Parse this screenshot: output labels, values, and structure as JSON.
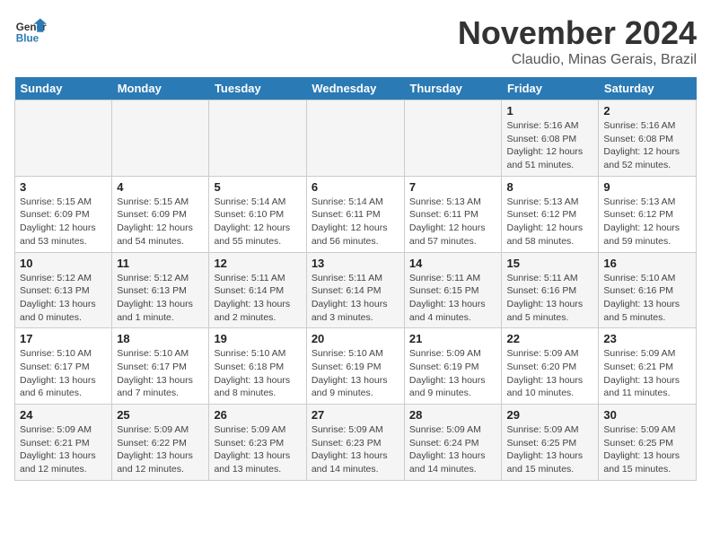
{
  "header": {
    "logo_line1": "General",
    "logo_line2": "Blue",
    "month_title": "November 2024",
    "location": "Claudio, Minas Gerais, Brazil"
  },
  "weekdays": [
    "Sunday",
    "Monday",
    "Tuesday",
    "Wednesday",
    "Thursday",
    "Friday",
    "Saturday"
  ],
  "weeks": [
    [
      {
        "day": "",
        "info": ""
      },
      {
        "day": "",
        "info": ""
      },
      {
        "day": "",
        "info": ""
      },
      {
        "day": "",
        "info": ""
      },
      {
        "day": "",
        "info": ""
      },
      {
        "day": "1",
        "info": "Sunrise: 5:16 AM\nSunset: 6:08 PM\nDaylight: 12 hours\nand 51 minutes."
      },
      {
        "day": "2",
        "info": "Sunrise: 5:16 AM\nSunset: 6:08 PM\nDaylight: 12 hours\nand 52 minutes."
      }
    ],
    [
      {
        "day": "3",
        "info": "Sunrise: 5:15 AM\nSunset: 6:09 PM\nDaylight: 12 hours\nand 53 minutes."
      },
      {
        "day": "4",
        "info": "Sunrise: 5:15 AM\nSunset: 6:09 PM\nDaylight: 12 hours\nand 54 minutes."
      },
      {
        "day": "5",
        "info": "Sunrise: 5:14 AM\nSunset: 6:10 PM\nDaylight: 12 hours\nand 55 minutes."
      },
      {
        "day": "6",
        "info": "Sunrise: 5:14 AM\nSunset: 6:11 PM\nDaylight: 12 hours\nand 56 minutes."
      },
      {
        "day": "7",
        "info": "Sunrise: 5:13 AM\nSunset: 6:11 PM\nDaylight: 12 hours\nand 57 minutes."
      },
      {
        "day": "8",
        "info": "Sunrise: 5:13 AM\nSunset: 6:12 PM\nDaylight: 12 hours\nand 58 minutes."
      },
      {
        "day": "9",
        "info": "Sunrise: 5:13 AM\nSunset: 6:12 PM\nDaylight: 12 hours\nand 59 minutes."
      }
    ],
    [
      {
        "day": "10",
        "info": "Sunrise: 5:12 AM\nSunset: 6:13 PM\nDaylight: 13 hours\nand 0 minutes."
      },
      {
        "day": "11",
        "info": "Sunrise: 5:12 AM\nSunset: 6:13 PM\nDaylight: 13 hours\nand 1 minute."
      },
      {
        "day": "12",
        "info": "Sunrise: 5:11 AM\nSunset: 6:14 PM\nDaylight: 13 hours\nand 2 minutes."
      },
      {
        "day": "13",
        "info": "Sunrise: 5:11 AM\nSunset: 6:14 PM\nDaylight: 13 hours\nand 3 minutes."
      },
      {
        "day": "14",
        "info": "Sunrise: 5:11 AM\nSunset: 6:15 PM\nDaylight: 13 hours\nand 4 minutes."
      },
      {
        "day": "15",
        "info": "Sunrise: 5:11 AM\nSunset: 6:16 PM\nDaylight: 13 hours\nand 5 minutes."
      },
      {
        "day": "16",
        "info": "Sunrise: 5:10 AM\nSunset: 6:16 PM\nDaylight: 13 hours\nand 5 minutes."
      }
    ],
    [
      {
        "day": "17",
        "info": "Sunrise: 5:10 AM\nSunset: 6:17 PM\nDaylight: 13 hours\nand 6 minutes."
      },
      {
        "day": "18",
        "info": "Sunrise: 5:10 AM\nSunset: 6:17 PM\nDaylight: 13 hours\nand 7 minutes."
      },
      {
        "day": "19",
        "info": "Sunrise: 5:10 AM\nSunset: 6:18 PM\nDaylight: 13 hours\nand 8 minutes."
      },
      {
        "day": "20",
        "info": "Sunrise: 5:10 AM\nSunset: 6:19 PM\nDaylight: 13 hours\nand 9 minutes."
      },
      {
        "day": "21",
        "info": "Sunrise: 5:09 AM\nSunset: 6:19 PM\nDaylight: 13 hours\nand 9 minutes."
      },
      {
        "day": "22",
        "info": "Sunrise: 5:09 AM\nSunset: 6:20 PM\nDaylight: 13 hours\nand 10 minutes."
      },
      {
        "day": "23",
        "info": "Sunrise: 5:09 AM\nSunset: 6:21 PM\nDaylight: 13 hours\nand 11 minutes."
      }
    ],
    [
      {
        "day": "24",
        "info": "Sunrise: 5:09 AM\nSunset: 6:21 PM\nDaylight: 13 hours\nand 12 minutes."
      },
      {
        "day": "25",
        "info": "Sunrise: 5:09 AM\nSunset: 6:22 PM\nDaylight: 13 hours\nand 12 minutes."
      },
      {
        "day": "26",
        "info": "Sunrise: 5:09 AM\nSunset: 6:23 PM\nDaylight: 13 hours\nand 13 minutes."
      },
      {
        "day": "27",
        "info": "Sunrise: 5:09 AM\nSunset: 6:23 PM\nDaylight: 13 hours\nand 14 minutes."
      },
      {
        "day": "28",
        "info": "Sunrise: 5:09 AM\nSunset: 6:24 PM\nDaylight: 13 hours\nand 14 minutes."
      },
      {
        "day": "29",
        "info": "Sunrise: 5:09 AM\nSunset: 6:25 PM\nDaylight: 13 hours\nand 15 minutes."
      },
      {
        "day": "30",
        "info": "Sunrise: 5:09 AM\nSunset: 6:25 PM\nDaylight: 13 hours\nand 15 minutes."
      }
    ]
  ]
}
